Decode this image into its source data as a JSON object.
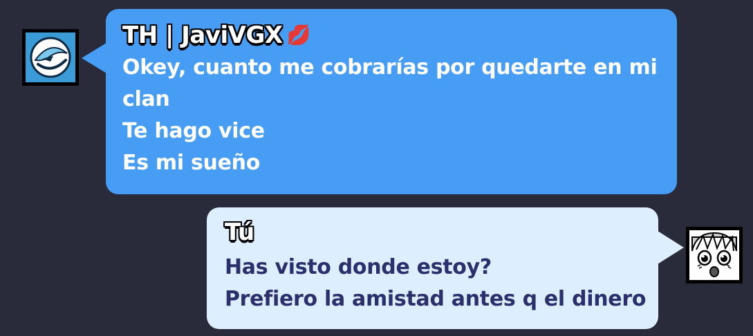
{
  "messages": [
    {
      "sender": "TH | JaviVGX",
      "sender_emoji": "💋",
      "avatar": "blue-emblem-avatar",
      "lines": [
        "Okey, cuanto me cobrarías por quedarte en mi",
        "clan",
        "Te hago vice",
        "Es mi sueño"
      ]
    },
    {
      "sender": "Tú",
      "avatar": "anime-face-avatar",
      "lines": [
        "Has visto donde estoy?",
        "Prefiero la amistad antes q el dinero"
      ]
    }
  ],
  "colors": {
    "background": "#2a2b3a",
    "incoming_bubble": "#479df3",
    "outgoing_bubble": "#ddeeff",
    "outgoing_text": "#2b2f6b"
  }
}
